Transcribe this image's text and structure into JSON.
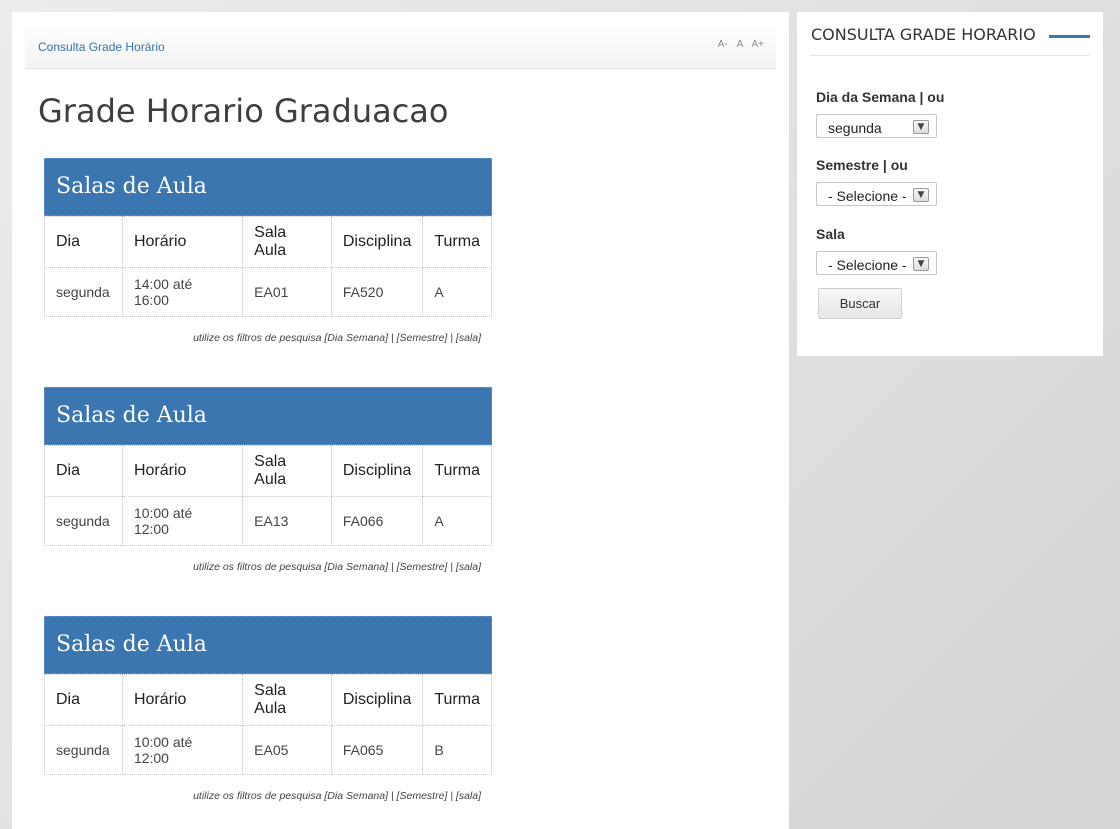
{
  "breadcrumb": {
    "label": "Consulta Grade Horário"
  },
  "font_sizer": {
    "decrease": "A-",
    "reset": "A",
    "increase": "A+"
  },
  "page": {
    "title": "Grade Horario Graduacao"
  },
  "blocks": [
    {
      "header": "Salas de Aula",
      "columns": [
        "Dia",
        "Horário",
        "Sala Aula",
        "Disciplina",
        "Turma"
      ],
      "row": [
        "segunda",
        "14:00 até 16:00",
        "EA01",
        "FA520",
        "A"
      ],
      "note": "utilize os filtros de pesquisa [Dia Semana] | [Semestre] | [sala]"
    },
    {
      "header": "Salas de Aula",
      "columns": [
        "Dia",
        "Horário",
        "Sala Aula",
        "Disciplina",
        "Turma"
      ],
      "row": [
        "segunda",
        "10:00 até 12:00",
        "EA13",
        "FA066",
        "A"
      ],
      "note": "utilize os filtros de pesquisa [Dia Semana] | [Semestre] | [sala]"
    },
    {
      "header": "Salas de Aula",
      "columns": [
        "Dia",
        "Horário",
        "Sala Aula",
        "Disciplina",
        "Turma"
      ],
      "row": [
        "segunda",
        "10:00 até 12:00",
        "EA05",
        "FA065",
        "B"
      ],
      "note": "utilize os filtros de pesquisa [Dia Semana] | [Semestre] | [sala]"
    }
  ],
  "sidebar": {
    "title": "CONSULTA GRADE HORARIO",
    "day_label": "Dia da Semana | ou",
    "day_value": "segunda",
    "semester_label": "Semestre | ou",
    "semester_value": "- Selecione -",
    "room_label": "Sala",
    "room_value": "- Selecione -",
    "search_button": "Buscar"
  },
  "colors": {
    "accent": "#3b76b0",
    "link": "#3a72a8",
    "background": "#e2e2e2"
  }
}
